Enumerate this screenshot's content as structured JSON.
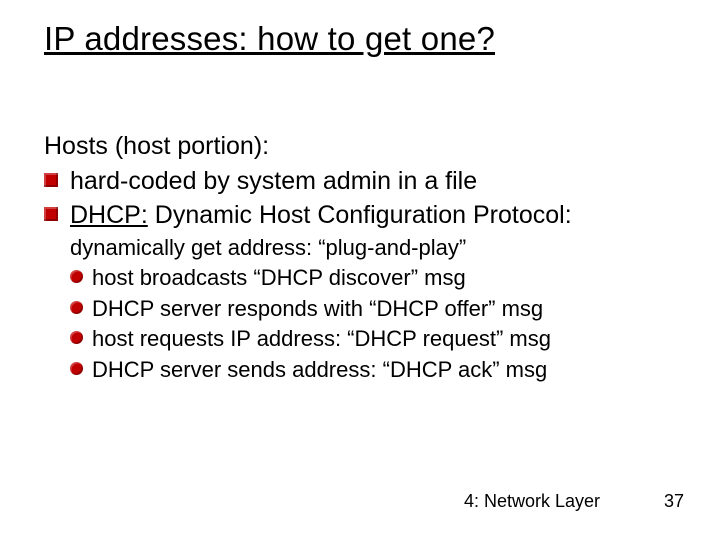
{
  "title": "IP addresses: how to get one?",
  "lead": "Hosts (host portion):",
  "items": [
    {
      "text": "hard-coded by system admin in a file"
    },
    {
      "term_ul": "DHCP:",
      "term_rest_D": "D",
      "term_rest_1": "ynamic ",
      "term_rest_H": "H",
      "term_rest_2": "ost ",
      "term_rest_C": "C",
      "term_rest_3": "onfiguration ",
      "term_rest_P": "P",
      "term_rest_4": "rotocol:",
      "subline": "dynamically get address: “plug-and-play”",
      "steps": [
        {
          "pre": "host broadcasts “",
          "em": "DHCP discover",
          "post": "” msg"
        },
        {
          "pre": "DHCP server responds with “",
          "em": "DHCP offer",
          "post": "” msg"
        },
        {
          "pre": "host requests IP address: “",
          "em": "DHCP request",
          "post": "” msg"
        },
        {
          "pre": "DHCP server sends address: “",
          "em": "DHCP ack",
          "post": "” msg"
        }
      ]
    }
  ],
  "footer": "4: Network Layer",
  "page": "37"
}
